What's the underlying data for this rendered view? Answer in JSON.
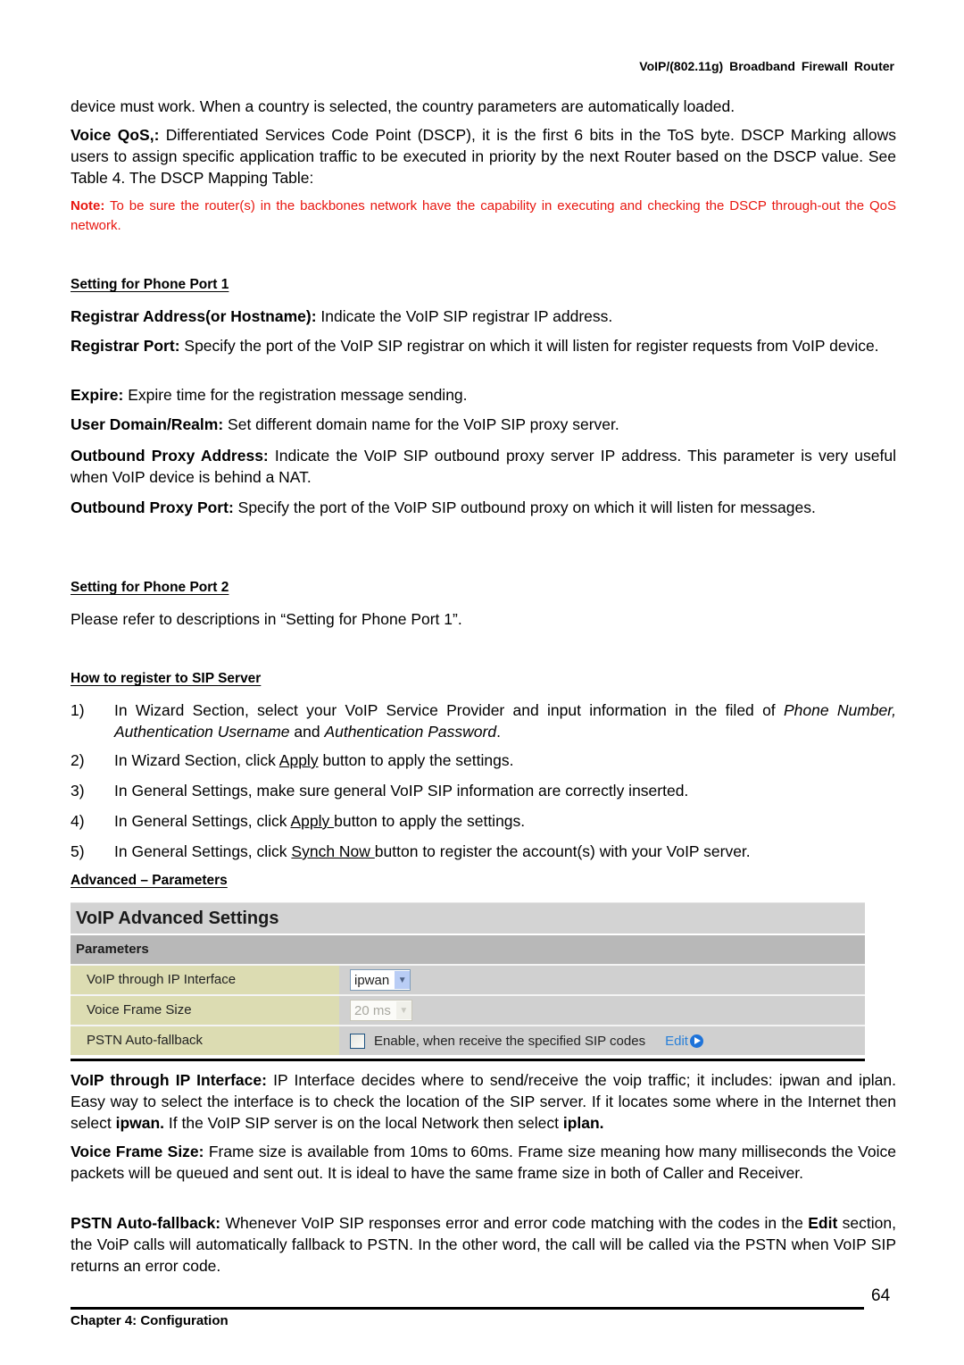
{
  "header": {
    "title": "VoIP/(802.11g)  Broadband  Firewall  Router"
  },
  "intro": {
    "country_sentence": "device must work. When a country is selected, the country parameters are automatically loaded.",
    "qos_label": "Voice QoS,:",
    "qos_text": " Differentiated Services Code Point (DSCP), it is the first 6 bits in the ToS byte. DSCP Marking allows users to assign specific application traffic to be executed in priority by the next Router based on the DSCP value.   See Table 4. The DSCP Mapping Table:",
    "note_label": "Note:",
    "note_text": " To be sure the router(s) in the backbones network have the capability in executing and checking the DSCP through-out the QoS network."
  },
  "phone_port1": {
    "heading": "Setting for Phone Port 1",
    "items": [
      {
        "label": "Registrar Address(or Hostname):",
        "text": " Indicate the VoIP SIP registrar IP address."
      },
      {
        "label": "Registrar Port:",
        "text": " Specify the port of the VoIP SIP registrar on which it will listen for register requests from VoIP device."
      },
      {
        "label": "Expire:",
        "text": " Expire time for the registration message sending."
      },
      {
        "label": "User Domain/Realm:",
        "text": " Set different domain name for the VoIP SIP proxy server."
      },
      {
        "label": "Outbound Proxy Address:",
        "text": " Indicate the VoIP SIP outbound proxy server IP address. This parameter is very useful when VoIP device is behind a NAT."
      },
      {
        "label": "Outbound Proxy Port:",
        "text": " Specify the port of the VoIP SIP outbound proxy on which it will listen for messages."
      }
    ]
  },
  "phone_port2": {
    "heading": "Setting for Phone Port 2",
    "text": "Please refer to descriptions in “Setting for Phone Port 1”."
  },
  "register": {
    "heading": "How to register to SIP Server",
    "steps": [
      {
        "num": "1)",
        "a": "In Wizard Section, select your VoIP Service Provider and input information in the filed of ",
        "i1": "Phone Number, Authentication Username",
        "b": " and ",
        "i2": "Authentication Password",
        "c": "."
      },
      {
        "num": "2)",
        "a": "In Wizard Section, click ",
        "link": "Apply",
        "b": " button to apply the settings."
      },
      {
        "num": "3)",
        "a": "In General Settings, make sure general VoIP SIP information are correctly inserted."
      },
      {
        "num": "4)",
        "a": "In General Settings, click ",
        "link": "Apply ",
        "b": "button to apply the settings."
      },
      {
        "num": "5)",
        "a": "In General Settings, click ",
        "link": "Synch Now ",
        "b": "button to register the account(s) with your VoIP server."
      }
    ]
  },
  "advanced": {
    "heading": "Advanced – Parameters "
  },
  "widget": {
    "title": "VoIP Advanced Settings",
    "section": "Parameters",
    "rows": [
      {
        "label": "VoIP through IP Interface",
        "select_value": "ipwan"
      },
      {
        "label": "Voice Frame Size",
        "select_value": "20 ms"
      },
      {
        "label": "PSTN Auto-fallback",
        "checkbox_label": "Enable, when receive the specified SIP codes",
        "checked": false,
        "edit_label": "Edit"
      }
    ]
  },
  "descriptions": {
    "ip_iface_label": "VoIP through IP Interface:",
    "ip_iface_text1": " IP Interface decides where to send/receive the voip traffic; it includes: ipwan and iplan.   Easy way to select the interface is to check the location of the SIP server.   If it locates some where in the Internet then select ",
    "ip_iface_b1": "ipwan.",
    "ip_iface_text2": "   If the VoIP SIP server is on the local Network then select ",
    "ip_iface_b2": "iplan.",
    "frame_label": "Voice Frame Size:",
    "frame_text": " Frame size is available from 10ms to 60ms.  Frame size meaning how many milliseconds the Voice packets will be queued and sent out.   It is ideal to have the same frame size in both of Caller and Receiver.",
    "pstn_label": "PSTN Auto-fallback:",
    "pstn_text1": " Whenever VoIP SIP responses error and error code matching with the codes in the ",
    "pstn_b": "Edit",
    "pstn_text2": " section, the VoiP calls will automatically fallback to PSTN.   In the other word, the call will be called via the PSTN when VoIP SIP returns an error code."
  },
  "footer": {
    "page_number": "64",
    "chapter": "Chapter 4: Configuration"
  },
  "colors": {
    "note": "#e8160f",
    "label_cell": "#dcdcb2",
    "value_cell": "#d0d0d0",
    "edit_link": "#2a80d8"
  }
}
